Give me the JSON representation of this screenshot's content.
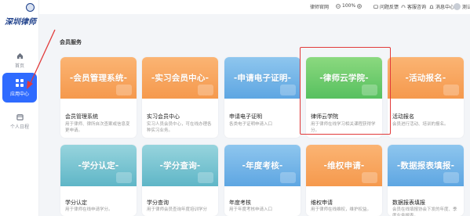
{
  "brand": {
    "name": "深圳律师"
  },
  "nav": [
    {
      "id": "home",
      "label": "首页",
      "icon": "home-icon"
    },
    {
      "id": "apps",
      "label": "应用中心",
      "icon": "apps-grid-icon",
      "active": true
    },
    {
      "id": "log",
      "label": "个人日程",
      "icon": "calendar-icon"
    }
  ],
  "topbar": {
    "official": "律师官网",
    "zoom": "100%",
    "feedback": "问题反馈",
    "service": "客服咨询",
    "messages": "消息中心",
    "user": "测试律师"
  },
  "section": {
    "title": "会员服务"
  },
  "cards_row1": [
    {
      "banner": "-会员管理系统-",
      "title": "会员管理系统",
      "desc": "用于律师、律所自次查案或信息变更申请。",
      "color": "orange"
    },
    {
      "banner": "-实习会员中心-",
      "title": "实习会员中心",
      "desc": "实习人员会员中心，可在线办理各种实习业务。",
      "color": "orange"
    },
    {
      "banner": "-申请电子证明-",
      "title": "申请电子证明",
      "desc": "各类电子证明申请入口",
      "color": "blue"
    },
    {
      "banner": "-律师云学院-",
      "title": "律师云学院",
      "desc": "用于律师在线学习相关课程获得学分。",
      "color": "green"
    },
    {
      "banner": "-活动报名-",
      "title": "活动报名",
      "desc": "会员进行活动、培训的报名。",
      "color": "orange"
    }
  ],
  "cards_row2": [
    {
      "banner": "-学分认定-",
      "title": "学分认定",
      "desc": "用于律师在线申请学分。",
      "color": "teal"
    },
    {
      "banner": "-学分查询-",
      "title": "学分查询",
      "desc": "用于律师会员查询年度培训学分",
      "color": "teal"
    },
    {
      "banner": "-年度考核-",
      "title": "年度考核",
      "desc": "用于年度考核申请入口",
      "color": "blue"
    },
    {
      "banner": "-维权申请-",
      "title": "维权申请",
      "desc": "用于律师在线维权，维护权益。",
      "color": "orange"
    },
    {
      "banner": "-数据报表填报-",
      "title": "数据报表填报",
      "desc": "会员在线填报协会下发的年度、季度业务报表。",
      "color": "blue"
    }
  ],
  "colors": {
    "accent": "#2f6bff",
    "highlight": "#e23a3a"
  }
}
